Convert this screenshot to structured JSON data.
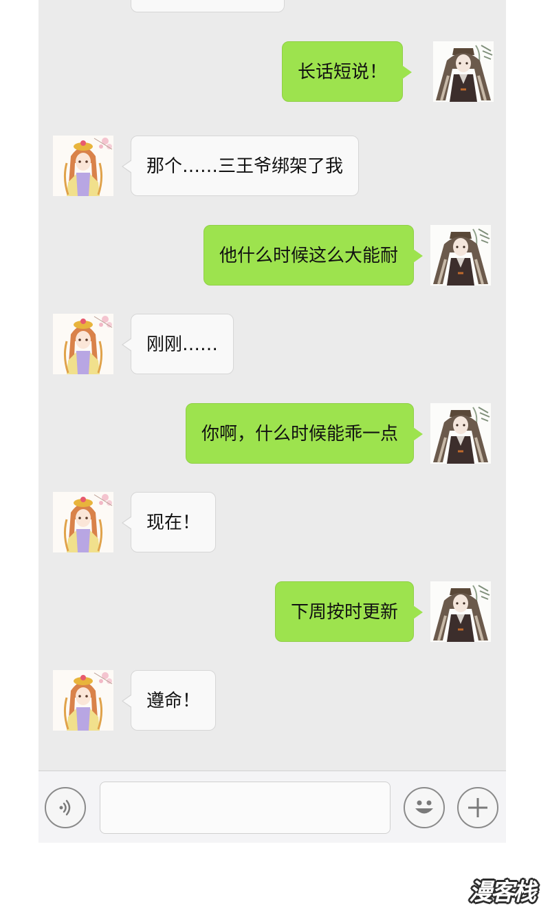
{
  "messages": [
    {
      "side": "in",
      "text": ""
    },
    {
      "side": "out",
      "text": "长话短说！"
    },
    {
      "side": "in",
      "text": "那个……三王爷绑架了我"
    },
    {
      "side": "out",
      "text": "他什么时候这么大能耐"
    },
    {
      "side": "in",
      "text": "刚刚……"
    },
    {
      "side": "out",
      "text": "你啊，什么时候能乖一点"
    },
    {
      "side": "in",
      "text": "现在！"
    },
    {
      "side": "out",
      "text": "下周按时更新"
    },
    {
      "side": "in",
      "text": "遵命！"
    }
  ],
  "input": {
    "value": ""
  },
  "icons": {
    "voice": "voice-icon",
    "emoji": "emoji-icon",
    "plus": "plus-icon",
    "avatar_girl": "avatar-girl-icon",
    "avatar_man": "avatar-man-icon"
  },
  "colors": {
    "chat_background": "#ebebeb",
    "outgoing_bubble": "#9de34e",
    "incoming_bubble": "#f9f9f9",
    "toolbar": "#f4f4f6"
  },
  "watermark": {
    "text": "漫客栈"
  }
}
